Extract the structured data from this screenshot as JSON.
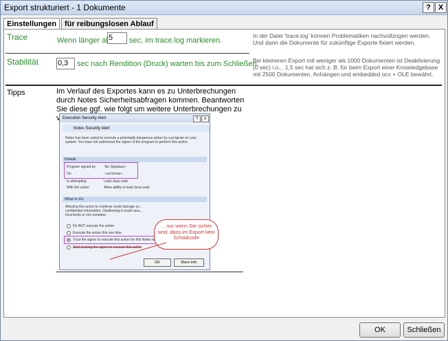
{
  "window": {
    "title": "Export strukturiert - 1 Dokumente",
    "help_label": "?",
    "close_label": "X"
  },
  "tabs": [
    {
      "label": "Einstellungen"
    },
    {
      "label": "für reibungslosen Ablauf"
    }
  ],
  "trace": {
    "label": "Trace",
    "prefix": "Wenn länger als",
    "value": "5",
    "suffix": "sec, im trace.log markieren.",
    "description": "In der Datei 'trace.log' können Problematiken nachvollzogen werden. Und dann die Dokumente für zukünftige Exporte fixiert werden."
  },
  "stability": {
    "label": "Stabilität",
    "value": "0,3",
    "suffix": "sec nach Rendition (Druck) warten bis zum Schließen.",
    "description": "Bei kleineren Export mit weniger als 1000 Dokumenten ist Deaktivierung (0 sec) i.o... 1,5 sec hat sich z. B. für beim Export einer Knowledgebase mit 2500 Dokumenten, Anhängen und embedded ocx + OLE bewährt."
  },
  "tips": {
    "label": "Tipps",
    "text": "Im Verlauf des Exportes kann es zu Unterbrechungen durch Notes Sicherheitsabfragen kommen. Beantworten Sie diese ggf. wie folgt um weitere Unterbrechungen zu vermeiden:"
  },
  "alert": {
    "title": "Execution Security Alert",
    "header": "Notes Security Alert",
    "intro": "Notes has been asked to execute a potentially dangerous action by a program on your system. You have not authorized the signer of the program to perform this action.",
    "details_label": "Details",
    "rows": [
      {
        "key": "Program signed by",
        "value": "-No Signature-"
      },
      {
        "key": "On",
        "value": "- not known -"
      },
      {
        "key": "Is attempting",
        "value": "Load Java code"
      },
      {
        "key": "With the action",
        "value": "Allow ability to load Java code"
      }
    ],
    "whattodo_label": "What to Do",
    "whattodo_text": "Allowing this action to continue could damage yo... confidential information. Disallowing it could caus... incorrectly or not complete.",
    "options": [
      {
        "label": "Do NOT execute the action"
      },
      {
        "label": "Execute the action this one time"
      },
      {
        "label": "Trust the signer to execute this action for this Notes session"
      },
      {
        "label": "Start trusting the signer to execute this action"
      }
    ],
    "ok_label": "OK",
    "more_info_label": "More Info",
    "callout": "... nur wenn Sie sicher sind, dass im Export kein Schadcode"
  },
  "buttons": {
    "ok": "OK",
    "close": "Schließen"
  }
}
